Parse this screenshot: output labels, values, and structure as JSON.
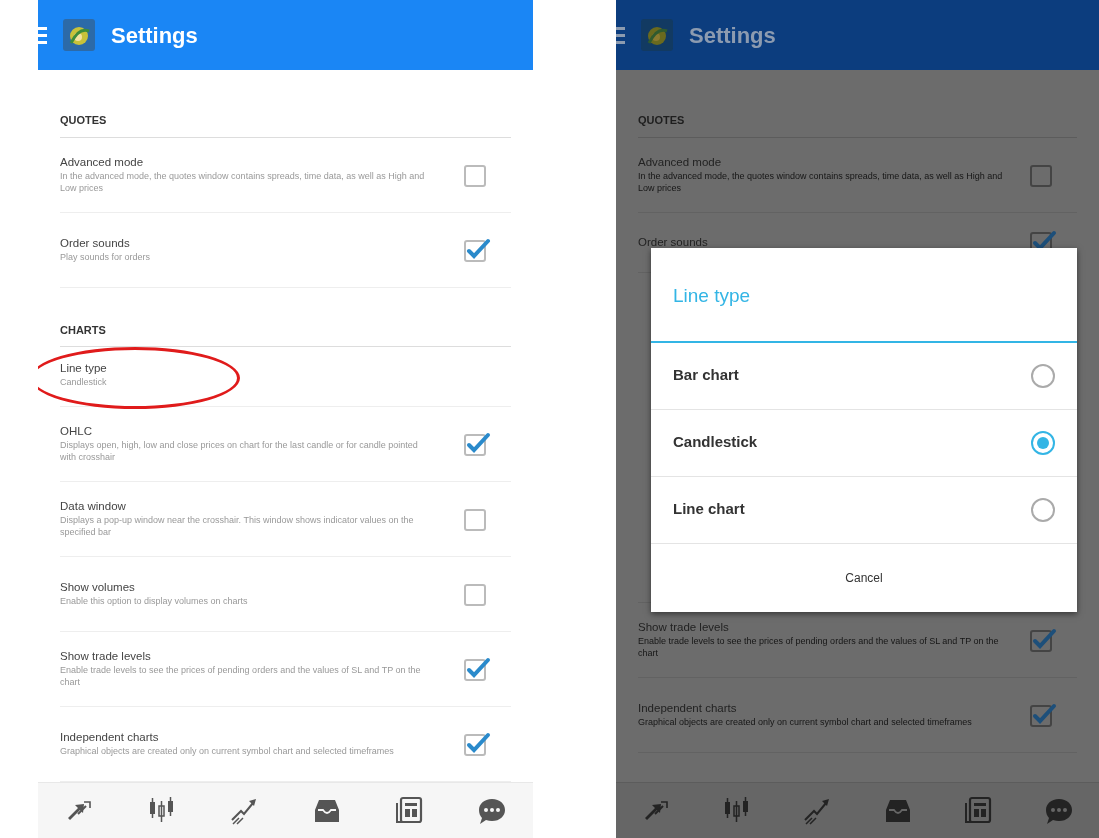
{
  "screens": [
    {
      "header": {
        "title": "Settings"
      },
      "dimmed": false,
      "sections": [
        {
          "title": "QUOTES",
          "items": [
            {
              "kind": "checkbox",
              "title": "Advanced mode",
              "description": "In the advanced mode, the quotes window contains spreads, time data, as well as High and Low prices",
              "checked": false
            },
            {
              "kind": "checkbox",
              "title": "Order sounds",
              "description": "Play sounds for orders",
              "checked": true
            }
          ]
        },
        {
          "title": "CHARTS",
          "items": [
            {
              "kind": "value",
              "title": "Line type",
              "value": "Candlestick",
              "highlighted": true
            },
            {
              "kind": "checkbox",
              "title": "OHLC",
              "description": "Displays open, high, low and close prices on chart for the last candle or for candle pointed with crosshair",
              "checked": true
            },
            {
              "kind": "checkbox",
              "title": "Data window",
              "description": "Displays a pop-up window near the crosshair. This window shows indicator values on the specified bar",
              "checked": false
            },
            {
              "kind": "checkbox",
              "title": "Show volumes",
              "description": "Enable this option to display volumes on charts",
              "checked": false
            },
            {
              "kind": "checkbox",
              "title": "Show trade levels",
              "description": "Enable trade levels to see the prices of pending orders and the values of SL and TP on the chart",
              "checked": true
            },
            {
              "kind": "checkbox",
              "title": "Independent charts",
              "description": "Graphical objects are created only on current symbol chart and selected timeframes",
              "checked": true
            }
          ]
        }
      ],
      "tab_bar": [
        {
          "kind": "quotes"
        },
        {
          "kind": "chart"
        },
        {
          "kind": "trade"
        },
        {
          "kind": "history"
        },
        {
          "kind": "news"
        },
        {
          "kind": "chat"
        }
      ]
    },
    {
      "header": {
        "title": "Settings"
      },
      "dimmed": true,
      "sections": [
        {
          "title": "QUOTES",
          "items": [
            {
              "kind": "checkbox",
              "title": "Advanced mode",
              "description": "In the advanced mode, the quotes window contains spreads, time data, as well as High and Low prices",
              "checked": false
            },
            {
              "kind": "checkbox",
              "title": "Order sounds",
              "checked": true
            }
          ]
        }
      ],
      "lower_items": [
        {
          "kind": "checkbox",
          "title": "Show trade levels",
          "description": "Enable trade levels to see the prices of pending orders and the values of SL and TP on the chart",
          "checked": true
        },
        {
          "kind": "checkbox",
          "title": "Independent charts",
          "description": "Graphical objects are created only on current symbol chart and selected timeframes",
          "checked": true
        }
      ],
      "dialog": {
        "title": "Line type",
        "options": [
          {
            "label": "Bar chart",
            "selected": false
          },
          {
            "label": "Candlestick",
            "selected": true
          },
          {
            "label": "Line chart",
            "selected": false
          }
        ],
        "cancel": "Cancel"
      },
      "tab_bar": [
        {
          "kind": "quotes"
        },
        {
          "kind": "chart"
        },
        {
          "kind": "trade"
        },
        {
          "kind": "history"
        },
        {
          "kind": "news"
        },
        {
          "kind": "chat"
        }
      ]
    }
  ]
}
